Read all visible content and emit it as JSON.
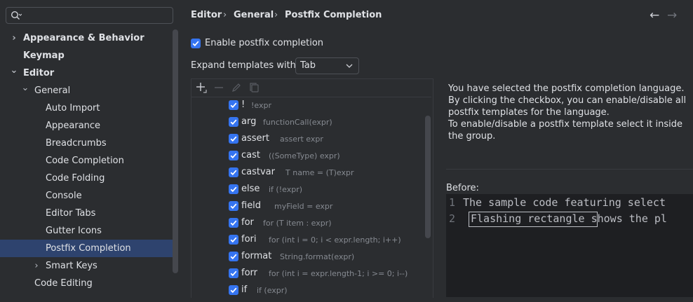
{
  "sidebar": {
    "search_placeholder": "",
    "items": [
      {
        "label": "Appearance & Behavior",
        "arrow": "›"
      },
      {
        "label": "Keymap",
        "arrow": ""
      },
      {
        "label": "Editor",
        "arrow": "⌄"
      },
      {
        "label": "General",
        "arrow": "⌄"
      },
      {
        "label": "Auto Import",
        "arrow": ""
      },
      {
        "label": "Appearance",
        "arrow": ""
      },
      {
        "label": "Breadcrumbs",
        "arrow": ""
      },
      {
        "label": "Code Completion",
        "arrow": ""
      },
      {
        "label": "Code Folding",
        "arrow": ""
      },
      {
        "label": "Console",
        "arrow": ""
      },
      {
        "label": "Editor Tabs",
        "arrow": ""
      },
      {
        "label": "Gutter Icons",
        "arrow": ""
      },
      {
        "label": "Postfix Completion",
        "arrow": ""
      },
      {
        "label": "Smart Keys",
        "arrow": "›"
      },
      {
        "label": "Code Editing",
        "arrow": ""
      }
    ]
  },
  "header": {
    "breadcrumb": [
      "Editor",
      "General",
      "Postfix Completion"
    ],
    "separator": "›",
    "back_icon": "←",
    "forward_icon": "→"
  },
  "settings": {
    "enable_label": "Enable postfix completion",
    "enable_checked": true,
    "expand_label": "Expand templates with",
    "expand_value": "Tab"
  },
  "toolbar": {
    "icons": [
      "add-icon",
      "remove-icon",
      "edit-icon",
      "copy-icon"
    ]
  },
  "templates": [
    {
      "key": "!",
      "example": "!expr"
    },
    {
      "key": "arg",
      "example": "functionCall(expr)"
    },
    {
      "key": "assert",
      "example": "assert expr"
    },
    {
      "key": "cast",
      "example": "((SomeType) expr)"
    },
    {
      "key": "castvar",
      "example": "T name = (T)expr"
    },
    {
      "key": "else",
      "example": "if (!expr)"
    },
    {
      "key": "field",
      "example": "myField = expr"
    },
    {
      "key": "for",
      "example": "for (T item : expr)"
    },
    {
      "key": "fori",
      "example": "for (int i = 0; i < expr.length; i++)"
    },
    {
      "key": "format",
      "example": "String.format(expr)"
    },
    {
      "key": "forr",
      "example": "for (int i = expr.length-1; i >= 0; i--)"
    },
    {
      "key": "if",
      "example": "if (expr)"
    }
  ],
  "description": {
    "lines": [
      "You have selected the postfix completion language.",
      "By clicking the checkbox, you can enable/disable all",
      "postfix templates for the language.",
      "To enable/disable a postfix template select it inside",
      "the group."
    ],
    "before_label": "Before:"
  },
  "code": {
    "lines": [
      {
        "num": "1",
        "text": "The sample code featuring select"
      },
      {
        "num": "2",
        "text": "Flashing rectangle shows the pl"
      }
    ]
  },
  "colors": {
    "accent": "#3574f0",
    "selection": "#2e436e",
    "background": "#2b2d30",
    "editor_bg": "#1e1f22"
  }
}
